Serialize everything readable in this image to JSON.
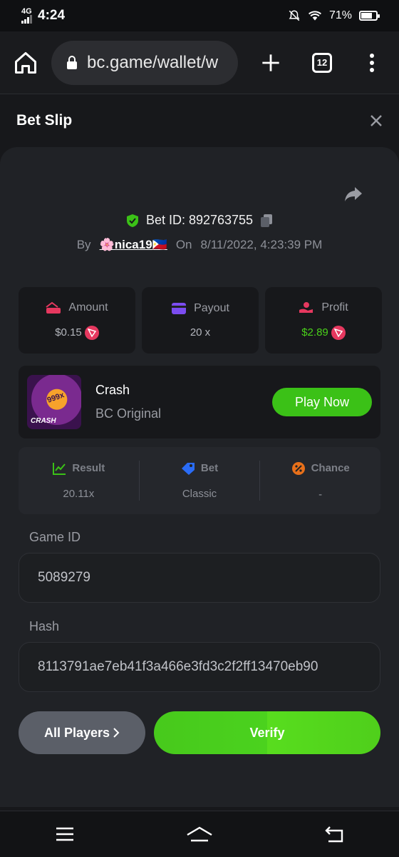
{
  "status_bar": {
    "network": "4G",
    "time": "4:24",
    "battery_percent": "71%"
  },
  "browser": {
    "url": "bc.game/wallet/w",
    "tab_count": "12"
  },
  "slip": {
    "title": "Bet Slip"
  },
  "bet": {
    "id_label": "Bet ID: 892763755",
    "by_label": "By",
    "username": "🌸nica19🇵🇭",
    "on_label": "On",
    "datetime": "8/11/2022, 4:23:39 PM"
  },
  "stats": [
    {
      "label": "Amount",
      "value": "$0.15"
    },
    {
      "label": "Payout",
      "value": "20 x"
    },
    {
      "label": "Profit",
      "value": "$2.89"
    }
  ],
  "game": {
    "name": "Crash",
    "subtitle": "BC Original",
    "play_label": "Play Now",
    "thumb_label": "CRASH",
    "thumb_badge": "999x"
  },
  "result": [
    {
      "label": "Result",
      "value": "20.11x"
    },
    {
      "label": "Bet",
      "value": "Classic"
    },
    {
      "label": "Chance",
      "value": "-"
    }
  ],
  "game_id": {
    "label": "Game ID",
    "value": "5089279"
  },
  "hash": {
    "label": "Hash",
    "value": "8113791ae7eb41f3a466e3fd3c2f2ff13470eb90"
  },
  "actions": {
    "players_label": "All Players",
    "verify_label": "Verify"
  },
  "colors": {
    "accent_green": "#3bc117",
    "profit_green": "#4ad01a",
    "amount_pink": "#e6385f",
    "payout_purple": "#7b4cf0",
    "bet_blue": "#2a6cf6",
    "chance_orange": "#e8701a"
  }
}
